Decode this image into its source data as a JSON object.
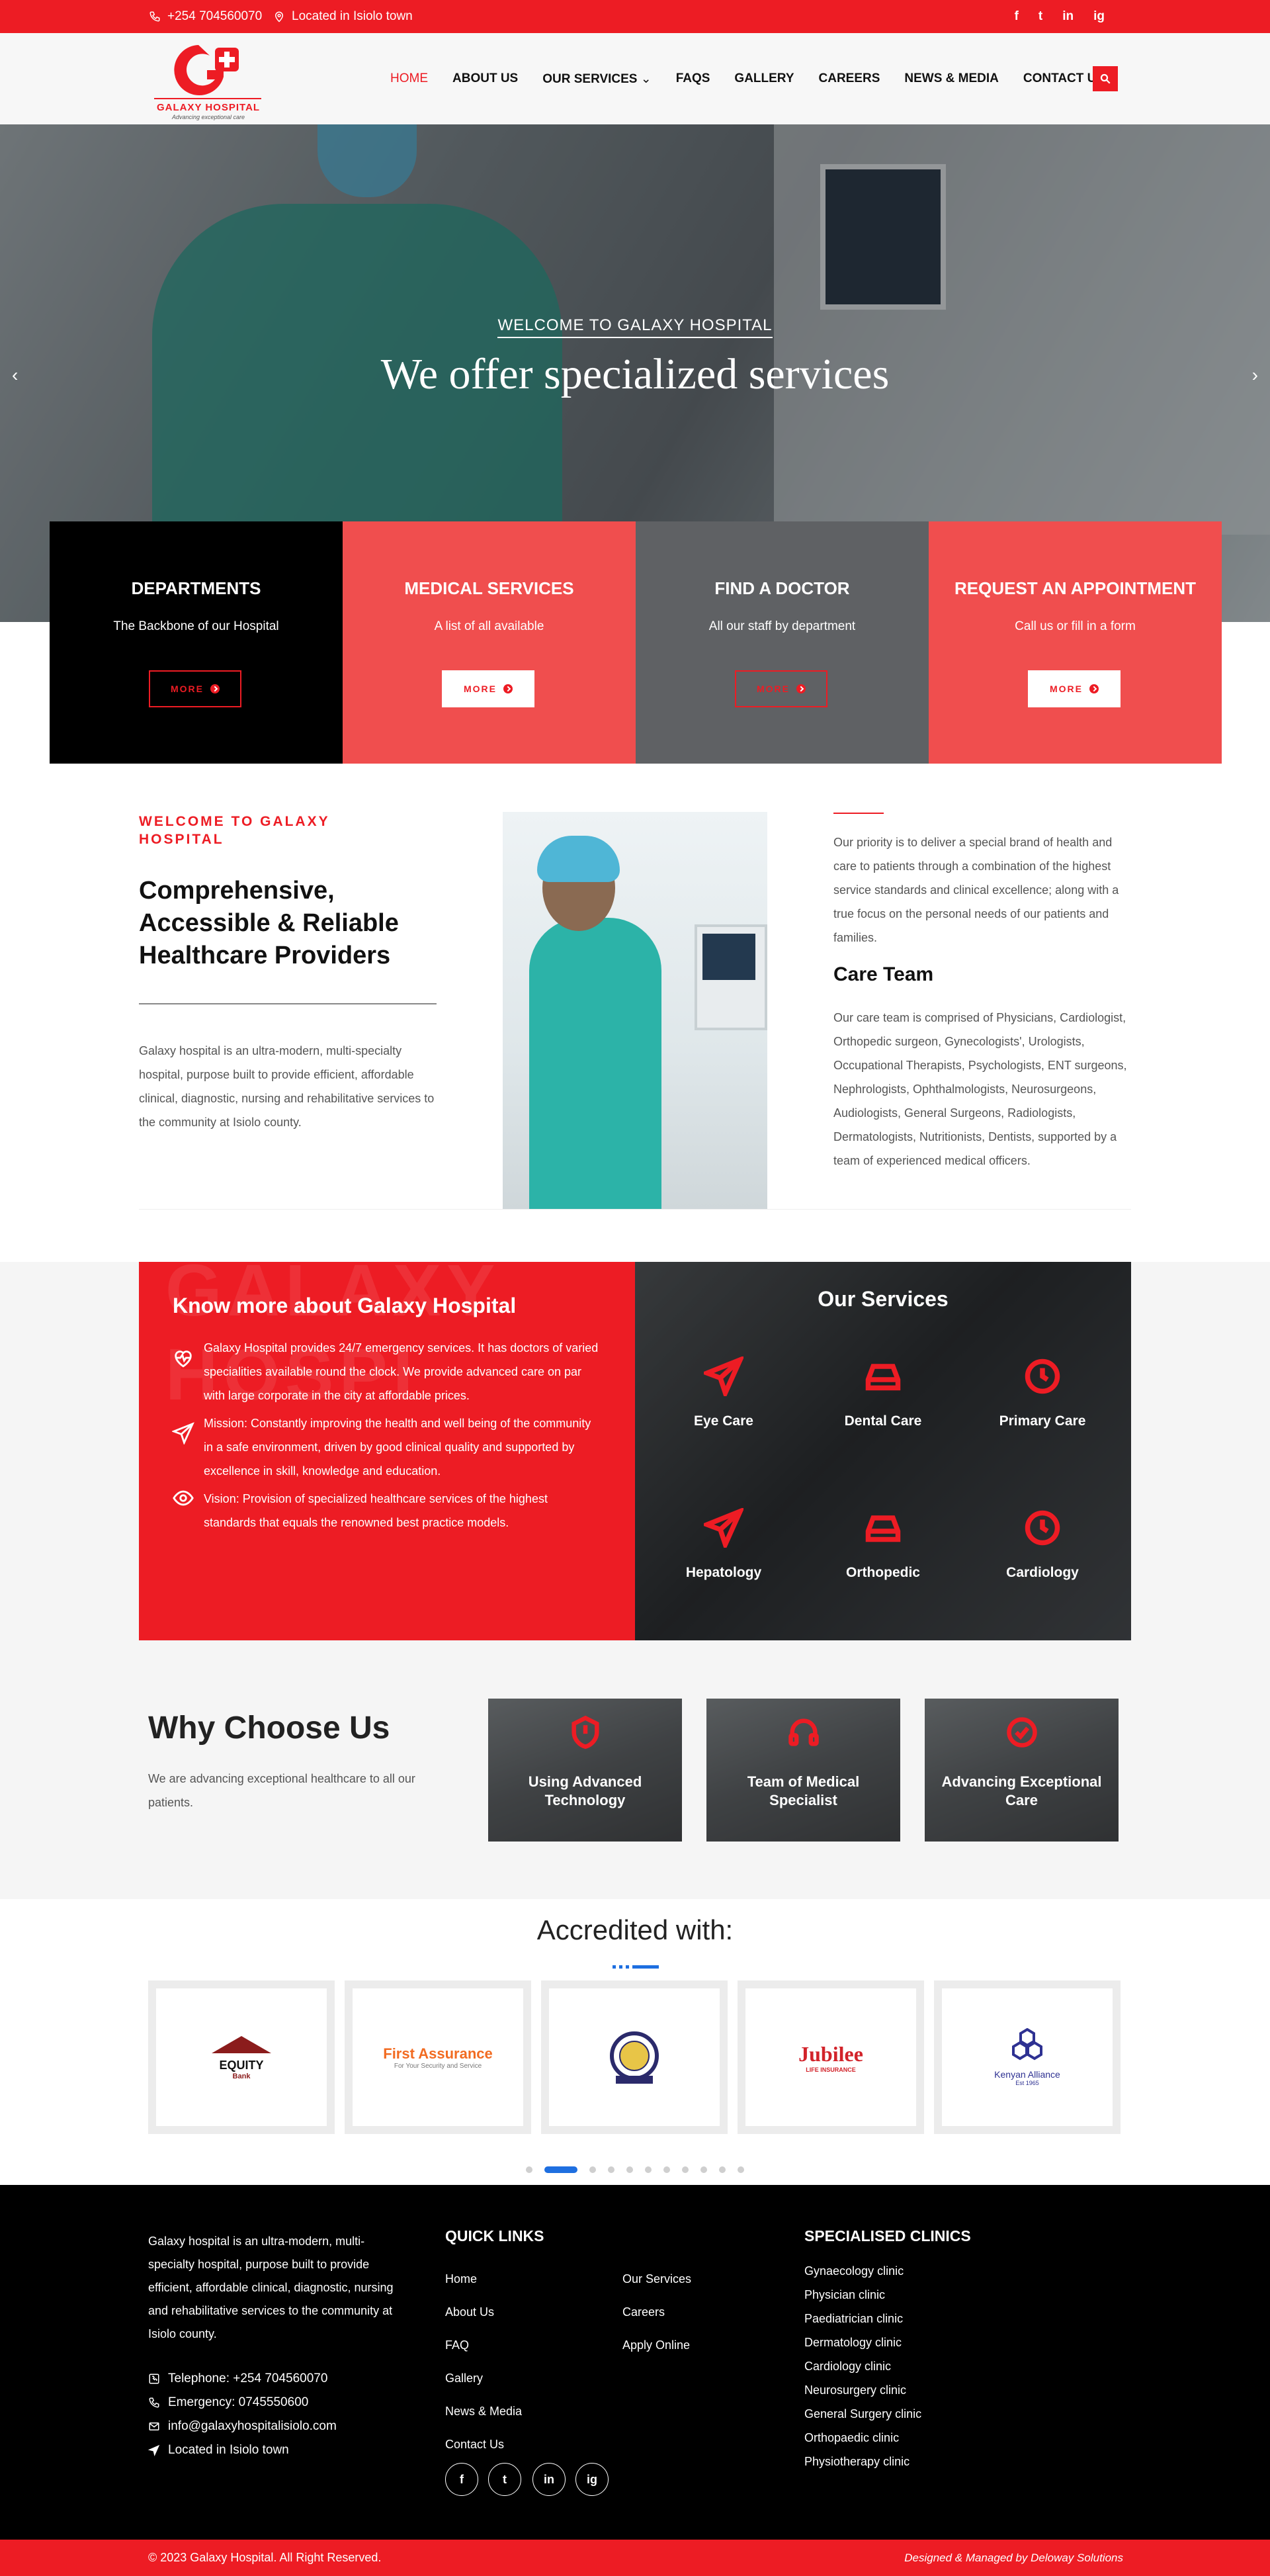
{
  "topbar": {
    "phone": "+254 704560070",
    "location": "Located in Isiolo town",
    "social": [
      "f",
      "t",
      "in",
      "ig"
    ]
  },
  "header": {
    "logo_title": "GALAXY HOSPITAL",
    "logo_tagline": "Advancing exceptional care",
    "nav": [
      "HOME",
      "ABOUT US",
      "OUR SERVICES",
      "FAQS",
      "GALLERY",
      "CAREERS",
      "NEWS & MEDIA",
      "CONTACT US"
    ],
    "active": "HOME"
  },
  "hero": {
    "welcome": "WELCOME TO GALAXY HOSPITAL",
    "headline": "We offer specialized services",
    "prev": "‹",
    "next": "›"
  },
  "features": [
    {
      "title": "DEPARTMENTS",
      "subtitle": "The Backbone of our Hospital",
      "button": "MORE"
    },
    {
      "title": "MEDICAL SERVICES",
      "subtitle": "A list of all available",
      "button": "MORE"
    },
    {
      "title": "FIND A DOCTOR",
      "subtitle": "All our staff by department",
      "button": "MORE"
    },
    {
      "title": "REQUEST AN APPOINTMENT",
      "subtitle": "Call us or fill in a form",
      "button": "MORE"
    }
  ],
  "about": {
    "kicker": "WELCOME TO GALAXY HOSPITAL",
    "title": "Comprehensive, Accessible & Reliable Healthcare Providers",
    "text": "Galaxy hospital is an ultra-modern, multi-specialty hospital, purpose built to provide efficient, affordable clinical, diagnostic, nursing and rehabilitative services to the community at Isiolo county.",
    "priority": "Our priority is to deliver a special brand of health and care to patients through a combination of the highest service standards and clinical excellence; along with a true focus on the personal needs of our patients and families.",
    "care_title": "Care Team",
    "care_text": "Our care team is comprised of Physicians, Cardiologist, Orthopedic surgeon, Gynecologists', Urologists, Occupational Therapists, Psychologists, ENT surgeons, Nephrologists, Ophthalmologists, Neurosurgeons, Audiologists, General Surgeons, Radiologists, Dermatologists, Nutritionists, Dentists, supported by a team of experienced medical officers."
  },
  "know": {
    "watermark": "GALAXY HOSPI",
    "title": "Know more about Galaxy Hospital",
    "items": [
      "Galaxy Hospital provides 24/7 emergency services. It has doctors of varied specialities available round the clock. We provide advanced care on par with large corporate in the city at affordable prices.",
      "Mission: Constantly improving the health and well being of the community in a safe environment, driven by good clinical quality and supported by excellence in skill, knowledge and education.",
      "Vision: Provision of specialized healthcare services of the highest standards that equals the renowned best practice models."
    ]
  },
  "services": {
    "title": "Our Services",
    "items": [
      "Eye Care",
      "Dental Care",
      "Primary Care",
      "Hepatology",
      "Orthopedic",
      "Cardiology"
    ]
  },
  "why": {
    "title": "Why Choose Us",
    "text": "We are advancing exceptional healthcare to all our patients.",
    "cards": [
      "Using Advanced Technology",
      "Team of Medical Specialist",
      "Advancing Exceptional Care"
    ]
  },
  "accredited": {
    "title": "Accredited with:",
    "logos": [
      {
        "name": "EQUITY",
        "sub": "Bank",
        "color": "#8b1c1c"
      },
      {
        "name": "First Assurance",
        "sub": "For Your Security and Service",
        "color": "#f26b21"
      },
      {
        "name": "SEAL",
        "sub": "",
        "color": "#2b2a6b"
      },
      {
        "name": "Jubilee",
        "sub": "LIFE INSURANCE",
        "color": "#d2232a"
      },
      {
        "name": "Kenyan Alliance",
        "sub": "Est 1965",
        "color": "#2e3192"
      }
    ],
    "accent": "#1e6fe0"
  },
  "footer": {
    "about": "Galaxy hospital is an ultra-modern, multi-specialty hospital, purpose built to provide efficient, affordable clinical, diagnostic, nursing and rehabilitative services to the community at Isiolo county.",
    "telephone": "Telephone: +254 704560070",
    "emergency": "Emergency: 0745550600",
    "email": "info@galaxyhospitalisiolo.com",
    "location": "Located in Isiolo town",
    "quick_links_title": "QUICK LINKS",
    "quick_links": [
      "Home",
      "About Us",
      "FAQ",
      "Gallery",
      "News & Media",
      "Contact Us"
    ],
    "quick_links_2": [
      "Our Services",
      "Careers",
      "Apply Online"
    ],
    "clinics_title": "SPECIALISED CLINICS",
    "clinics": [
      "Gynaecology clinic",
      "Physician clinic",
      "Paediatrician clinic",
      "Dermatology clinic",
      "Cardiology clinic",
      "Neurosurgery clinic",
      "General Surgery clinic",
      "Orthopaedic clinic",
      "Physiotherapy clinic"
    ],
    "social": [
      "f",
      "t",
      "in",
      "ig"
    ],
    "copyright": "© 2023 Galaxy Hospital. All Right Reserved.",
    "credit": "Designed & Managed by Deloway Solutions"
  },
  "colors": {
    "brand": "#ed1c24",
    "dark": "#000000",
    "gray": "#5f6164",
    "coral": "#f04e4e"
  }
}
